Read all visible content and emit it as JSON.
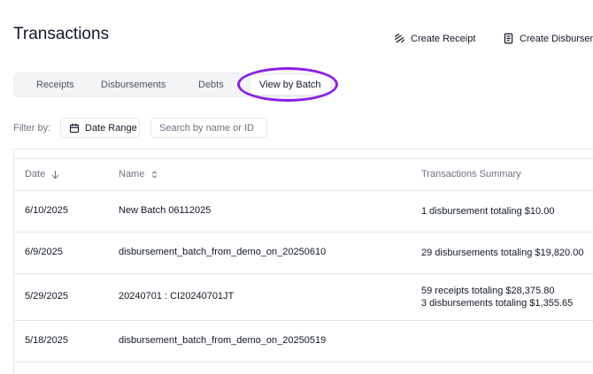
{
  "header": {
    "title": "Transactions",
    "create_receipt_label": "Create Receipt",
    "create_disbursement_label": "Create Disbursement"
  },
  "tabs": [
    {
      "label": "Receipts",
      "active": false
    },
    {
      "label": "Disbursements",
      "active": false
    },
    {
      "label": "Debts",
      "active": false
    },
    {
      "label": "View by Batch",
      "active": true
    }
  ],
  "highlight_color": "#8b1fe6",
  "filter": {
    "label": "Filter by:",
    "date_range_label": "Date Range",
    "search_placeholder": "Search by name or ID",
    "search_value": ""
  },
  "table": {
    "columns": {
      "date": "Date",
      "name": "Name",
      "summary": "Transactions Summary"
    },
    "rows": [
      {
        "date": "6/10/2025",
        "name": "New Batch 06112025",
        "summary": [
          "1 disbursement totaling $10.00"
        ]
      },
      {
        "date": "6/9/2025",
        "name": "disbursement_batch_from_demo_on_20250610",
        "summary": [
          "29 disbursements totaling $19,820.00"
        ]
      },
      {
        "date": "5/29/2025",
        "name": "20240701 : CI20240701JT",
        "summary": [
          "59 receipts totaling $28,375.80",
          "3 disbursements totaling $1,355.65"
        ]
      },
      {
        "date": "5/18/2025",
        "name": "disbursement_batch_from_demo_on_20250519",
        "summary": []
      }
    ]
  }
}
